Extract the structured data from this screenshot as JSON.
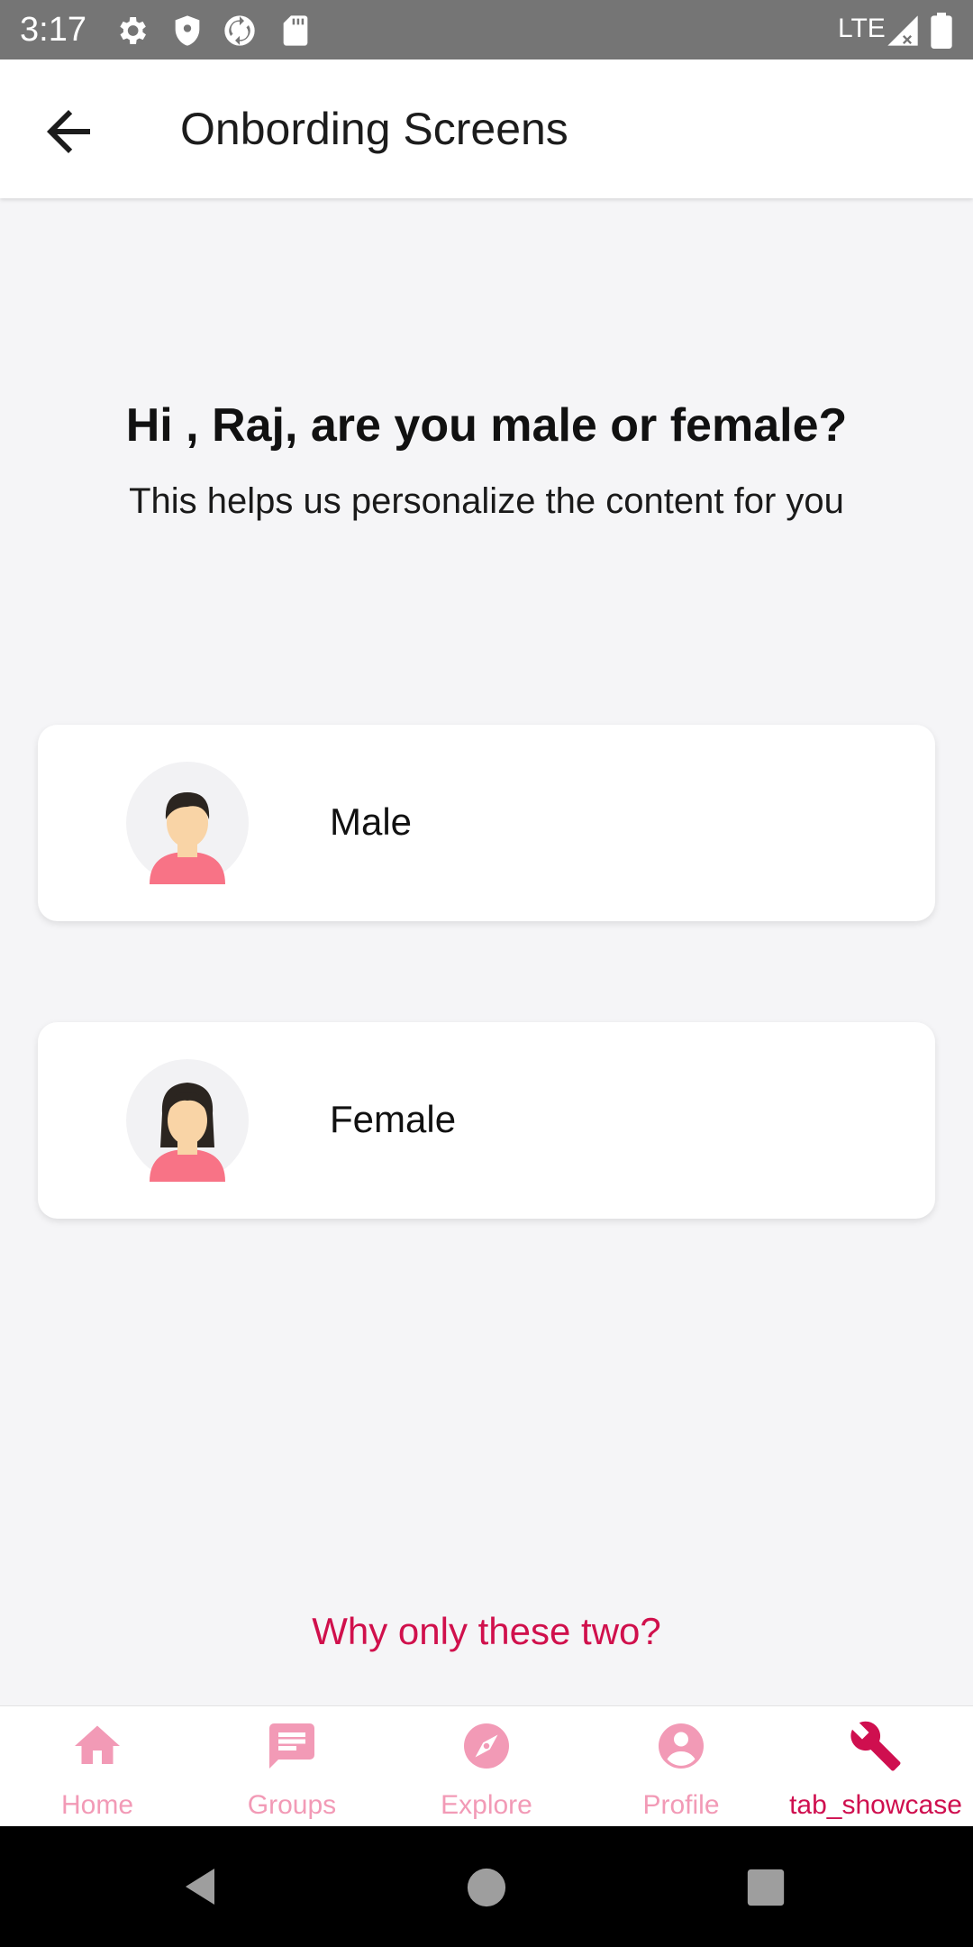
{
  "status_bar": {
    "time": "3:17",
    "network": "LTE"
  },
  "app_bar": {
    "title": "Onbording Screens"
  },
  "prompt": {
    "headline": "Hi , Raj,  are you male or female?",
    "subtitle": "This helps us personalize the content for you"
  },
  "options": [
    {
      "label": "Male",
      "icon": "male-avatar-icon"
    },
    {
      "label": "Female",
      "icon": "female-avatar-icon"
    }
  ],
  "why_link": "Why only these two?",
  "bottom_nav": {
    "items": [
      {
        "label": "Home",
        "icon": "home-icon",
        "active": false
      },
      {
        "label": "Groups",
        "icon": "chat-icon",
        "active": false
      },
      {
        "label": "Explore",
        "icon": "compass-icon",
        "active": false
      },
      {
        "label": "Profile",
        "icon": "account-icon",
        "active": false
      },
      {
        "label": "tab_showcase",
        "icon": "wrench-icon",
        "active": true
      }
    ]
  },
  "colors": {
    "accent": "#cf0f4f",
    "inactive_tab": "#f29ab6",
    "background": "#f5f5f7",
    "status_bar": "#757575"
  }
}
